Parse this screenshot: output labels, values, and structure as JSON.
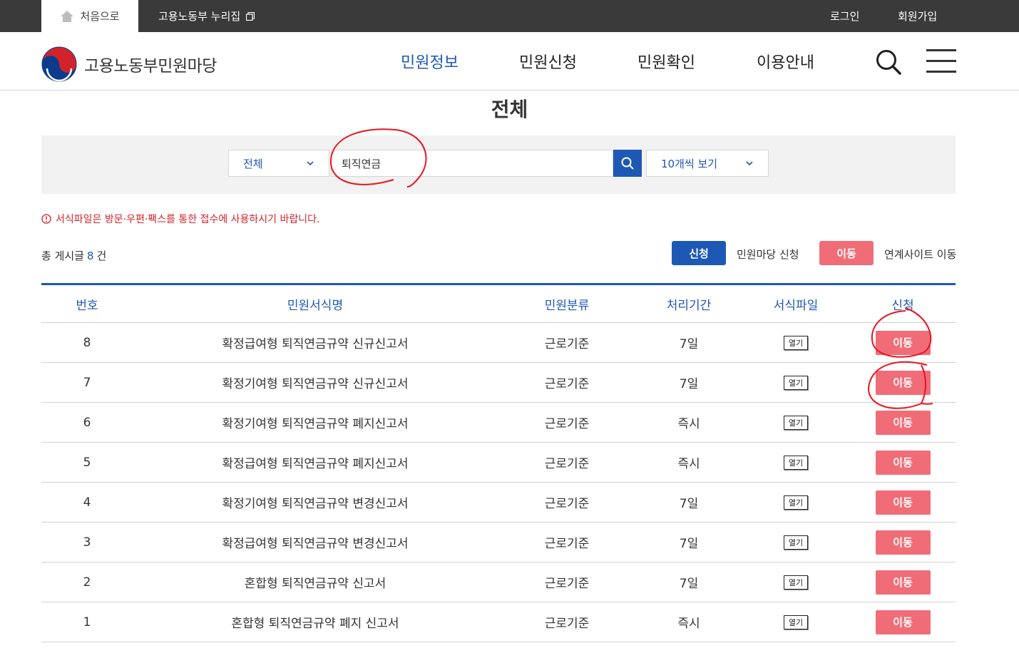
{
  "topbar": {
    "home_label": "처음으로",
    "nuri_label": "고용노동부 누리집",
    "login_label": "로그인",
    "join_label": "회원가입"
  },
  "header": {
    "site_name": "고용노동부민원마당",
    "nav": [
      "민원정보",
      "민원신청",
      "민원확인",
      "이용안내"
    ],
    "active_nav": "민원정보"
  },
  "page": {
    "title": "전체"
  },
  "search": {
    "category_value": "전체",
    "query_value": "퇴직연금",
    "page_size_value": "10개씩 보기"
  },
  "notice": {
    "text": "서식파일은 방문·우편·팩스를 통한 접수에 사용하시기 바랍니다."
  },
  "summary": {
    "total_prefix": "총 게시글",
    "total_count": "8",
    "total_suffix": "건",
    "legend_apply_label": "신청",
    "legend_apply_desc": "민원마당 신청",
    "legend_move_label": "이동",
    "legend_move_desc": "연계사이트 이동"
  },
  "table": {
    "headers": [
      "번호",
      "민원서식명",
      "민원분류",
      "처리기간",
      "서식파일",
      "신청"
    ],
    "rows": [
      {
        "num": "8",
        "name": "확정급여형 퇴직연금규약 신규신고서",
        "category": "근로기준",
        "period": "7일",
        "file": "열기",
        "action": "이동"
      },
      {
        "num": "7",
        "name": "확정기여형 퇴직연금규약 신규신고서",
        "category": "근로기준",
        "period": "7일",
        "file": "열기",
        "action": "이동"
      },
      {
        "num": "6",
        "name": "확정기여형 퇴직연금규약 폐지신고서",
        "category": "근로기준",
        "period": "즉시",
        "file": "열기",
        "action": "이동"
      },
      {
        "num": "5",
        "name": "확정급여형 퇴직연금규약 폐지신고서",
        "category": "근로기준",
        "period": "즉시",
        "file": "열기",
        "action": "이동"
      },
      {
        "num": "4",
        "name": "확정기여형 퇴직연금규약 변경신고서",
        "category": "근로기준",
        "period": "7일",
        "file": "열기",
        "action": "이동"
      },
      {
        "num": "3",
        "name": "확정급여형 퇴직연금규약 변경신고서",
        "category": "근로기준",
        "period": "7일",
        "file": "열기",
        "action": "이동"
      },
      {
        "num": "2",
        "name": "혼합형 퇴직연금규약 신고서",
        "category": "근로기준",
        "period": "7일",
        "file": "열기",
        "action": "이동"
      },
      {
        "num": "1",
        "name": "혼합형 퇴직연금규약 폐지 신고서",
        "category": "근로기준",
        "period": "즉시",
        "file": "열기",
        "action": "이동"
      }
    ]
  },
  "colors": {
    "primary": "#1e58b5",
    "move": "#f06d78",
    "notice": "#d2232a",
    "annotation": "#e8141c"
  }
}
